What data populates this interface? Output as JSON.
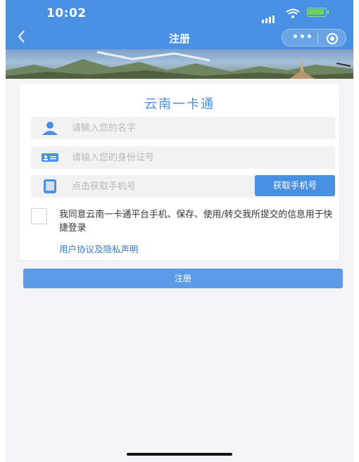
{
  "status": {
    "time": "10:02"
  },
  "navbar": {
    "title": "注册"
  },
  "card": {
    "heading": "云南一卡通",
    "name_placeholder": "请输入您的名字",
    "id_placeholder": "请输入您的身份证号",
    "phone_placeholder": "点击获取手机号",
    "get_phone_label": "获取手机号",
    "agree_text": "我同意云南一卡通平台手机、保存、使用/转交我所提交的信息用于快捷登录",
    "agreement_link": "用户协议及隐私声明"
  },
  "register_label": "注册",
  "icons": [
    "signal-icon",
    "wifi-icon",
    "battery-icon",
    "back-icon",
    "more-icon",
    "target-icon",
    "user-icon",
    "id-card-icon",
    "phone-icon"
  ],
  "colors": {
    "accent": "#4a90e2",
    "link": "#3a78c9",
    "field_bg": "#f2f2f2"
  }
}
